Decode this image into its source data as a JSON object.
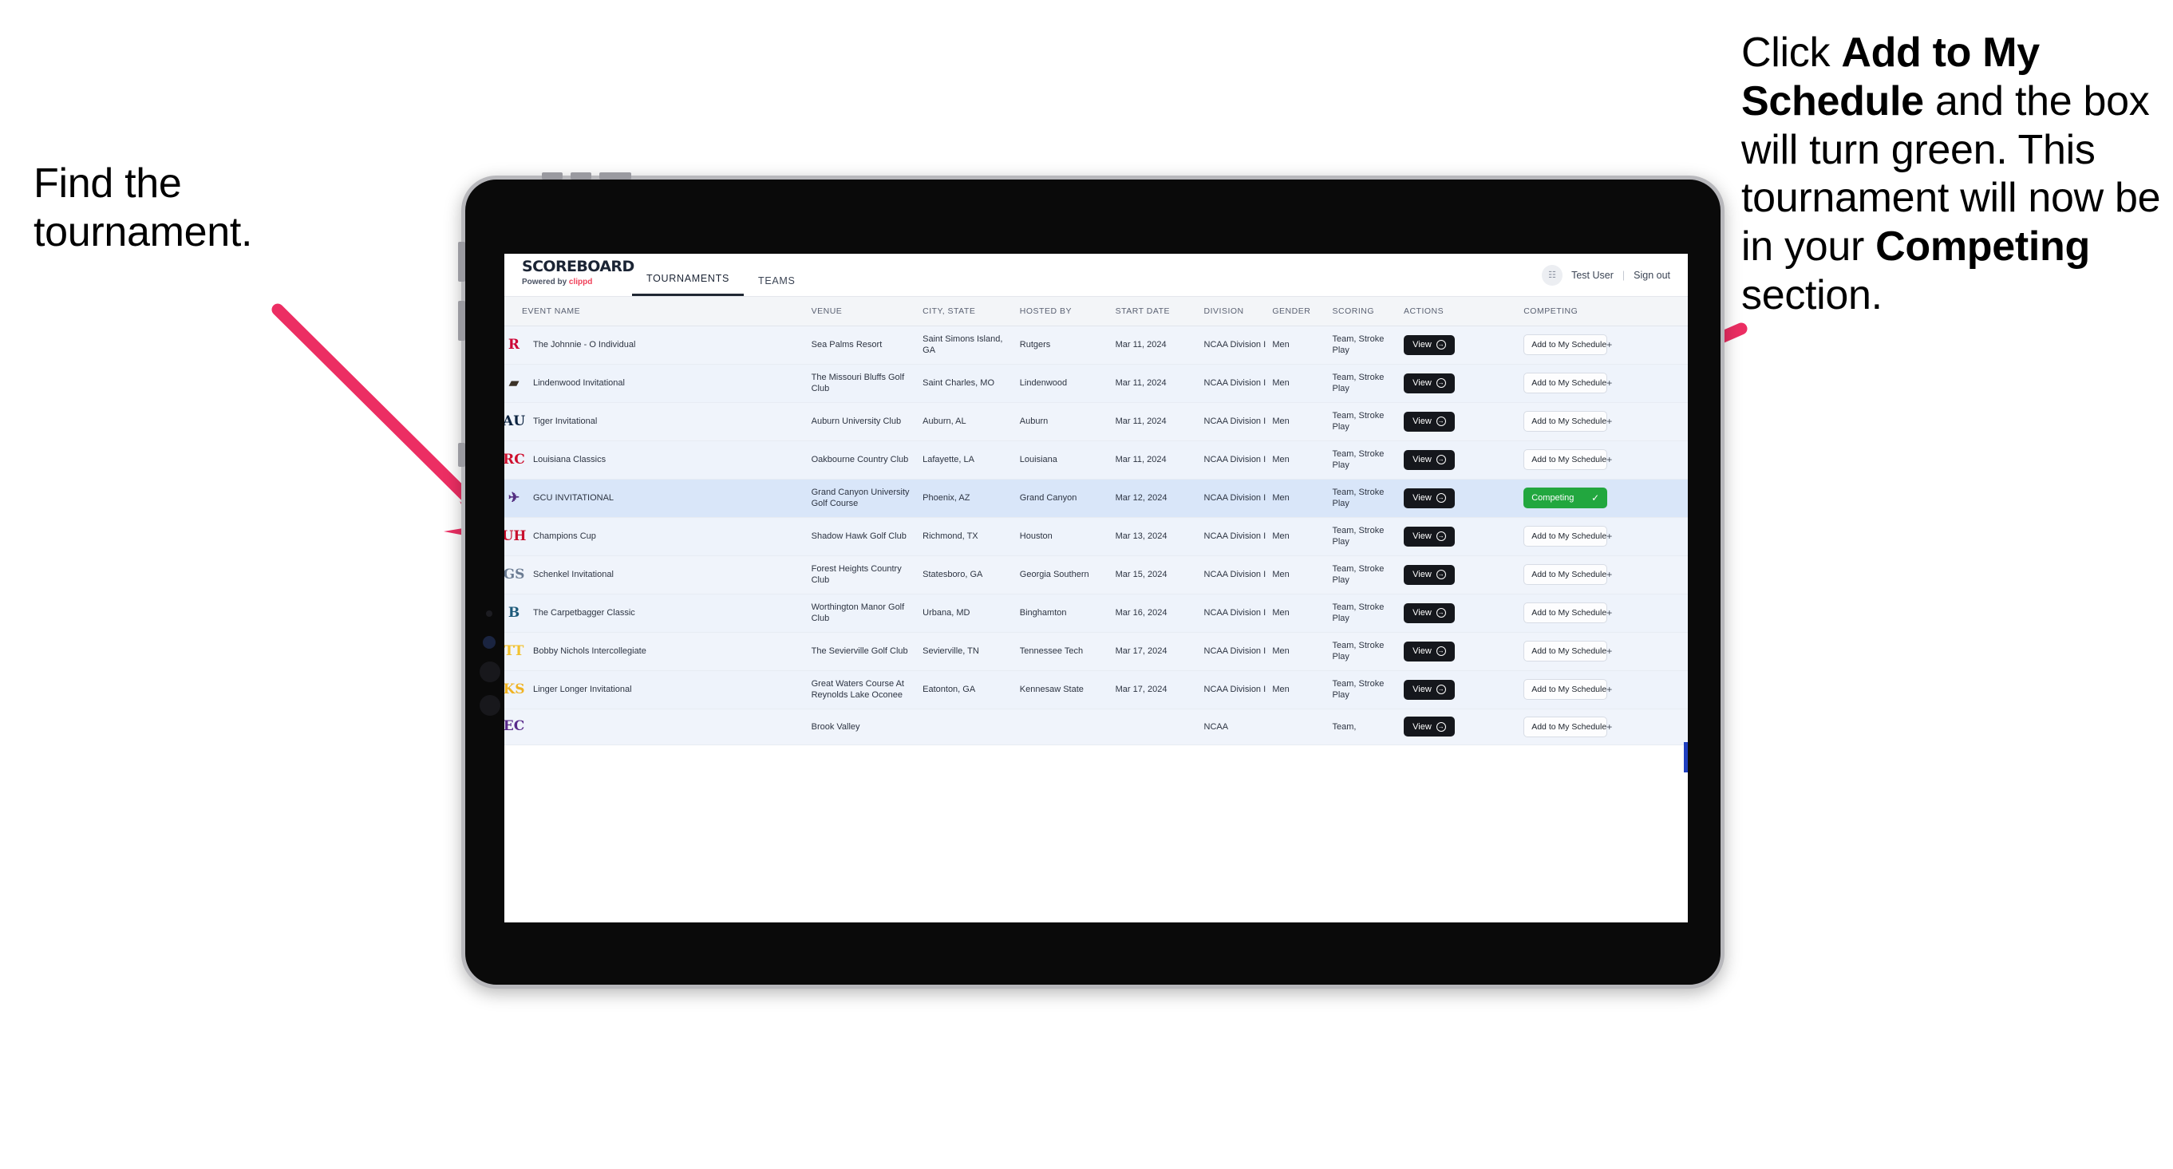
{
  "annotations": {
    "left": "Find the tournament.",
    "right_html": "Click <b>Add to My Schedule</b> and the box will turn green. This tournament will now be in your <b>Competing</b> section.",
    "arrow_color": "#ec2e63"
  },
  "app": {
    "brand": {
      "title": "SCOREBOARD",
      "powered_prefix": "Powered by ",
      "powered_brand": "clippd"
    },
    "nav": [
      {
        "label": "TOURNAMENTS",
        "active": true
      },
      {
        "label": "TEAMS",
        "active": false
      }
    ],
    "account": {
      "avatar_icon": "user-avatar-icon",
      "user": "Test User",
      "separator": "|",
      "sign_out": "Sign out"
    },
    "table": {
      "columns": [
        "EVENT NAME",
        "VENUE",
        "CITY, STATE",
        "HOSTED BY",
        "START DATE",
        "DIVISION",
        "GENDER",
        "SCORING",
        "ACTIONS",
        "COMPETING"
      ],
      "action_view_label": "View",
      "add_label": "Add to My Schedule",
      "add_plus": "+",
      "competing_label": "Competing",
      "competing_check": "✓",
      "competing_color": "#22a73f",
      "rows": [
        {
          "logo": "R",
          "logo_color": "#cc0033",
          "logo_bg": "transparent",
          "event": "The Johnnie - O Individual",
          "venue": "Sea Palms Resort",
          "city": "Saint Simons Island, GA",
          "host": "Rutgers",
          "date": "Mar 11, 2024",
          "division": "NCAA Division I",
          "gender": "Men",
          "scoring": "Team, Stroke Play",
          "competing": false
        },
        {
          "logo": "▰",
          "logo_color": "#3b3127",
          "logo_bg": "transparent",
          "event": "Lindenwood Invitational",
          "venue": "The Missouri Bluffs Golf Club",
          "city": "Saint Charles, MO",
          "host": "Lindenwood",
          "date": "Mar 11, 2024",
          "division": "NCAA Division I",
          "gender": "Men",
          "scoring": "Team, Stroke Play",
          "competing": false
        },
        {
          "logo": "AU",
          "logo_color": "#0c2340",
          "logo_bg": "transparent",
          "event": "Tiger Invitational",
          "venue": "Auburn University Club",
          "city": "Auburn, AL",
          "host": "Auburn",
          "date": "Mar 11, 2024",
          "division": "NCAA Division I",
          "gender": "Men",
          "scoring": "Team, Stroke Play",
          "competing": false
        },
        {
          "logo": "RC",
          "logo_color": "#ce0e2d",
          "logo_bg": "transparent",
          "event": "Louisiana Classics",
          "venue": "Oakbourne Country Club",
          "city": "Lafayette, LA",
          "host": "Louisiana",
          "date": "Mar 11, 2024",
          "division": "NCAA Division I",
          "gender": "Men",
          "scoring": "Team, Stroke Play",
          "competing": false
        },
        {
          "logo": "✈",
          "logo_color": "#522d80",
          "logo_bg": "transparent",
          "event": "GCU INVITATIONAL",
          "venue": "Grand Canyon University Golf Course",
          "city": "Phoenix, AZ",
          "host": "Grand Canyon",
          "date": "Mar 12, 2024",
          "division": "NCAA Division I",
          "gender": "Men",
          "scoring": "Team, Stroke Play",
          "competing": true
        },
        {
          "logo": "UH",
          "logo_color": "#c8102e",
          "logo_bg": "transparent",
          "event": "Champions Cup",
          "venue": "Shadow Hawk Golf Club",
          "city": "Richmond, TX",
          "host": "Houston",
          "date": "Mar 13, 2024",
          "division": "NCAA Division I",
          "gender": "Men",
          "scoring": "Team, Stroke Play",
          "competing": false
        },
        {
          "logo": "GS",
          "logo_color": "#6b7c93",
          "logo_bg": "transparent",
          "event": "Schenkel Invitational",
          "venue": "Forest Heights Country Club",
          "city": "Statesboro, GA",
          "host": "Georgia Southern",
          "date": "Mar 15, 2024",
          "division": "NCAA Division I",
          "gender": "Men",
          "scoring": "Team, Stroke Play",
          "competing": false
        },
        {
          "logo": "B",
          "logo_color": "#1d5a7a",
          "logo_bg": "transparent",
          "event": "The Carpetbagger Classic",
          "venue": "Worthington Manor Golf Club",
          "city": "Urbana, MD",
          "host": "Binghamton",
          "date": "Mar 16, 2024",
          "division": "NCAA Division I",
          "gender": "Men",
          "scoring": "Team, Stroke Play",
          "competing": false
        },
        {
          "logo": "TT",
          "logo_color": "#f2c230",
          "logo_bg": "transparent",
          "event": "Bobby Nichols Intercollegiate",
          "venue": "The Sevierville Golf Club",
          "city": "Sevierville, TN",
          "host": "Tennessee Tech",
          "date": "Mar 17, 2024",
          "division": "NCAA Division I",
          "gender": "Men",
          "scoring": "Team, Stroke Play",
          "competing": false
        },
        {
          "logo": "KS",
          "logo_color": "#f0b323",
          "logo_bg": "transparent",
          "event": "Linger Longer Invitational",
          "venue": "Great Waters Course At Reynolds Lake Oconee",
          "city": "Eatonton, GA",
          "host": "Kennesaw State",
          "date": "Mar 17, 2024",
          "division": "NCAA Division I",
          "gender": "Men",
          "scoring": "Team, Stroke Play",
          "competing": false
        },
        {
          "logo": "EC",
          "logo_color": "#592a8a",
          "logo_bg": "transparent",
          "event": "",
          "venue": "Brook Valley",
          "city": "",
          "host": "",
          "date": "",
          "division": "NCAA",
          "gender": "",
          "scoring": "Team,",
          "competing": false,
          "clipped": true
        }
      ]
    }
  }
}
